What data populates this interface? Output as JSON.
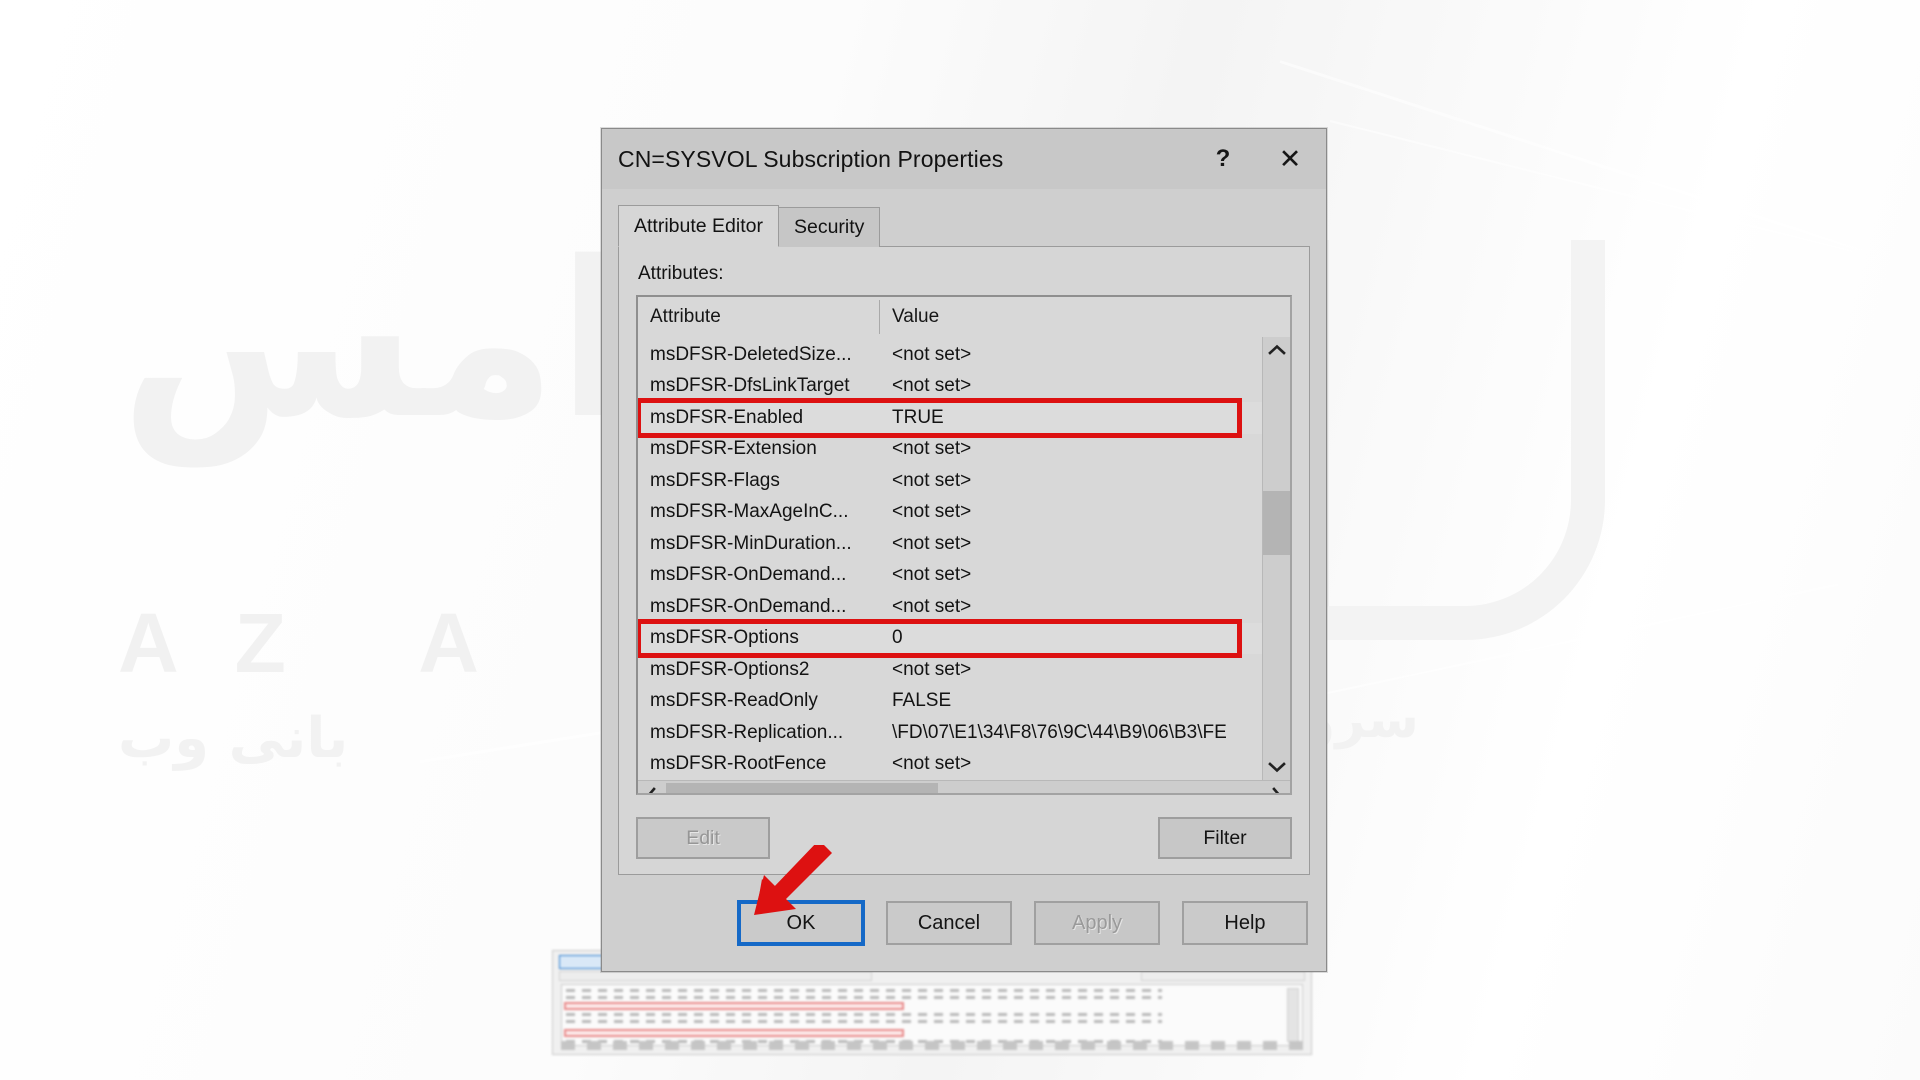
{
  "window": {
    "title": "CN=SYSVOL Subscription Properties",
    "help_button": "?",
    "close_button": "✕"
  },
  "tabs": [
    {
      "label": "Attribute Editor",
      "active": true
    },
    {
      "label": "Security",
      "active": false
    }
  ],
  "attribute_editor": {
    "section_label": "Attributes:",
    "columns": [
      "Attribute",
      "Value"
    ],
    "rows": [
      {
        "attribute": "msDFSR-DeletedSize...",
        "value": "<not set>",
        "highlight": false
      },
      {
        "attribute": "msDFSR-DfsLinkTarget",
        "value": "<not set>",
        "highlight": false
      },
      {
        "attribute": "msDFSR-Enabled",
        "value": "TRUE",
        "highlight": true
      },
      {
        "attribute": "msDFSR-Extension",
        "value": "<not set>",
        "highlight": false
      },
      {
        "attribute": "msDFSR-Flags",
        "value": "<not set>",
        "highlight": false
      },
      {
        "attribute": "msDFSR-MaxAgeInC...",
        "value": "<not set>",
        "highlight": false
      },
      {
        "attribute": "msDFSR-MinDuration...",
        "value": "<not set>",
        "highlight": false
      },
      {
        "attribute": "msDFSR-OnDemand...",
        "value": "<not set>",
        "highlight": false
      },
      {
        "attribute": "msDFSR-OnDemand...",
        "value": "<not set>",
        "highlight": false
      },
      {
        "attribute": "msDFSR-Options",
        "value": "0",
        "highlight": true
      },
      {
        "attribute": "msDFSR-Options2",
        "value": "<not set>",
        "highlight": false
      },
      {
        "attribute": "msDFSR-ReadOnly",
        "value": "FALSE",
        "highlight": false
      },
      {
        "attribute": "msDFSR-Replication...",
        "value": "\\FD\\07\\E1\\34\\F8\\76\\9C\\44\\B9\\06\\B3\\FE",
        "highlight": false
      },
      {
        "attribute": "msDFSR-RootFence",
        "value": "<not set>",
        "highlight": false
      }
    ],
    "edit_button": "Edit",
    "edit_button_enabled": false,
    "filter_button": "Filter",
    "filter_button_enabled": true
  },
  "footer_buttons": [
    {
      "label": "OK",
      "enabled": true,
      "focused": true
    },
    {
      "label": "Cancel",
      "enabled": true,
      "focused": false
    },
    {
      "label": "Apply",
      "enabled": false,
      "focused": false
    },
    {
      "label": "Help",
      "enabled": true,
      "focused": false
    }
  ],
  "annotations": {
    "arrow_color": "#DD1111",
    "highlight_box_color": "#DD1111",
    "focus_ring_color": "#1569C7"
  },
  "watermark": {
    "arabic_text": "آرامس",
    "latin_text": "AZ  A        S  Y  S",
    "arabic_secondary": "بانی وب",
    "arabic_tertiary": "سرویس"
  }
}
